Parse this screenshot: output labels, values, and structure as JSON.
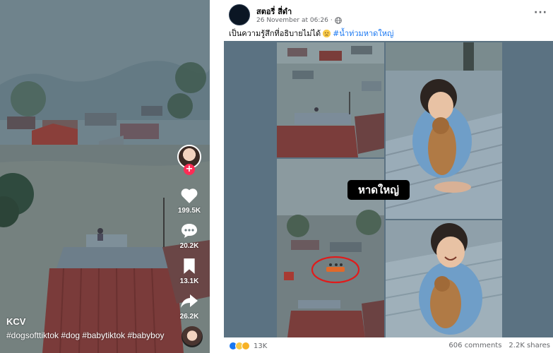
{
  "tiktok": {
    "username": "KCV",
    "caption": "#dogsofttiktok #dog #babytiktok #babyboy",
    "actions": {
      "likes": "199.5K",
      "comments": "20.2K",
      "saves": "13.1K",
      "shares": "26.2K"
    },
    "accent_color": "#fe2c55"
  },
  "facebook": {
    "page_name": "สตอรี่ สี่ดำ",
    "avatar_text": "",
    "timestamp": "26 November at 06:26",
    "post_text": "เป็นความรู้สึกที่อธิบายไม่ได้",
    "hashtag": "#น้ำท่วมหาดใหญ่",
    "image_label": "หาดใหญ่",
    "reaction_count": "13K",
    "comments": "606 comments",
    "shares": "2.2K shares",
    "link_color": "#1877f2"
  }
}
